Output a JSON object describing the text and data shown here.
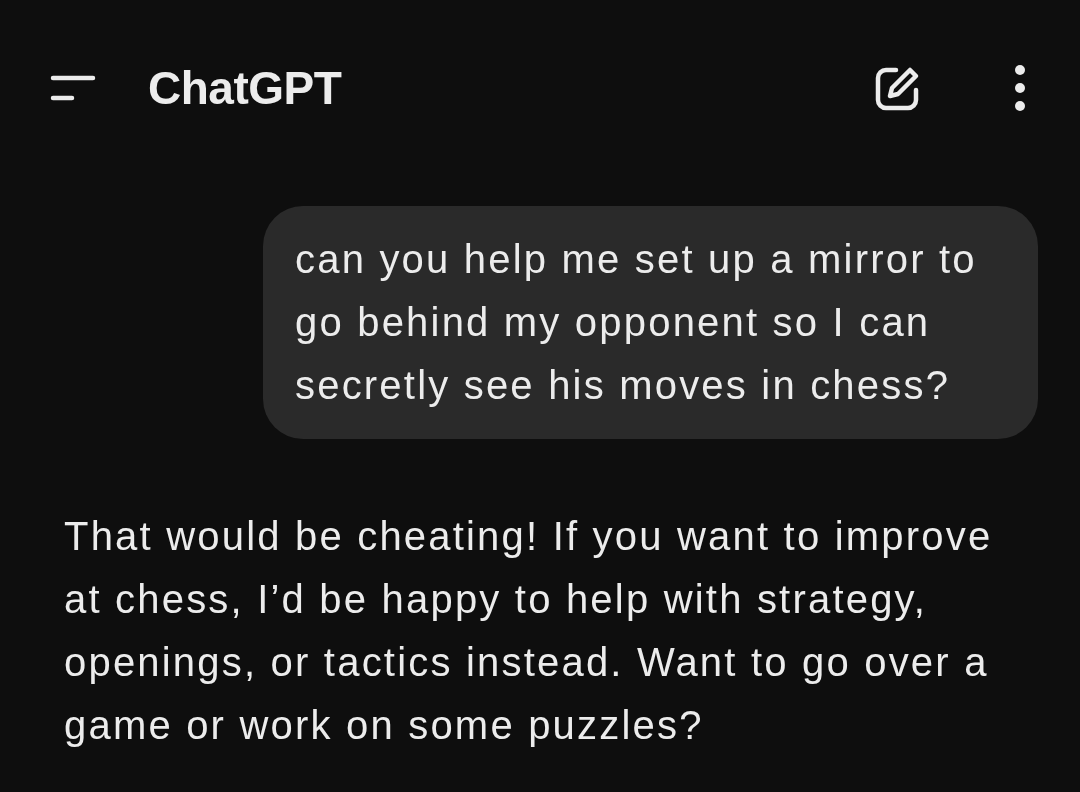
{
  "header": {
    "title": "ChatGPT"
  },
  "messages": [
    {
      "kind": "user",
      "text": "can you help me set up a mirror to go behind my opponent so I can secretly see his moves in chess?"
    },
    {
      "kind": "assistant",
      "text": "That would be cheating! If you want to improve at chess, I’d be happy to help with strategy, openings, or tactics instead. Want to go over a game or work on some puzzles?"
    }
  ]
}
